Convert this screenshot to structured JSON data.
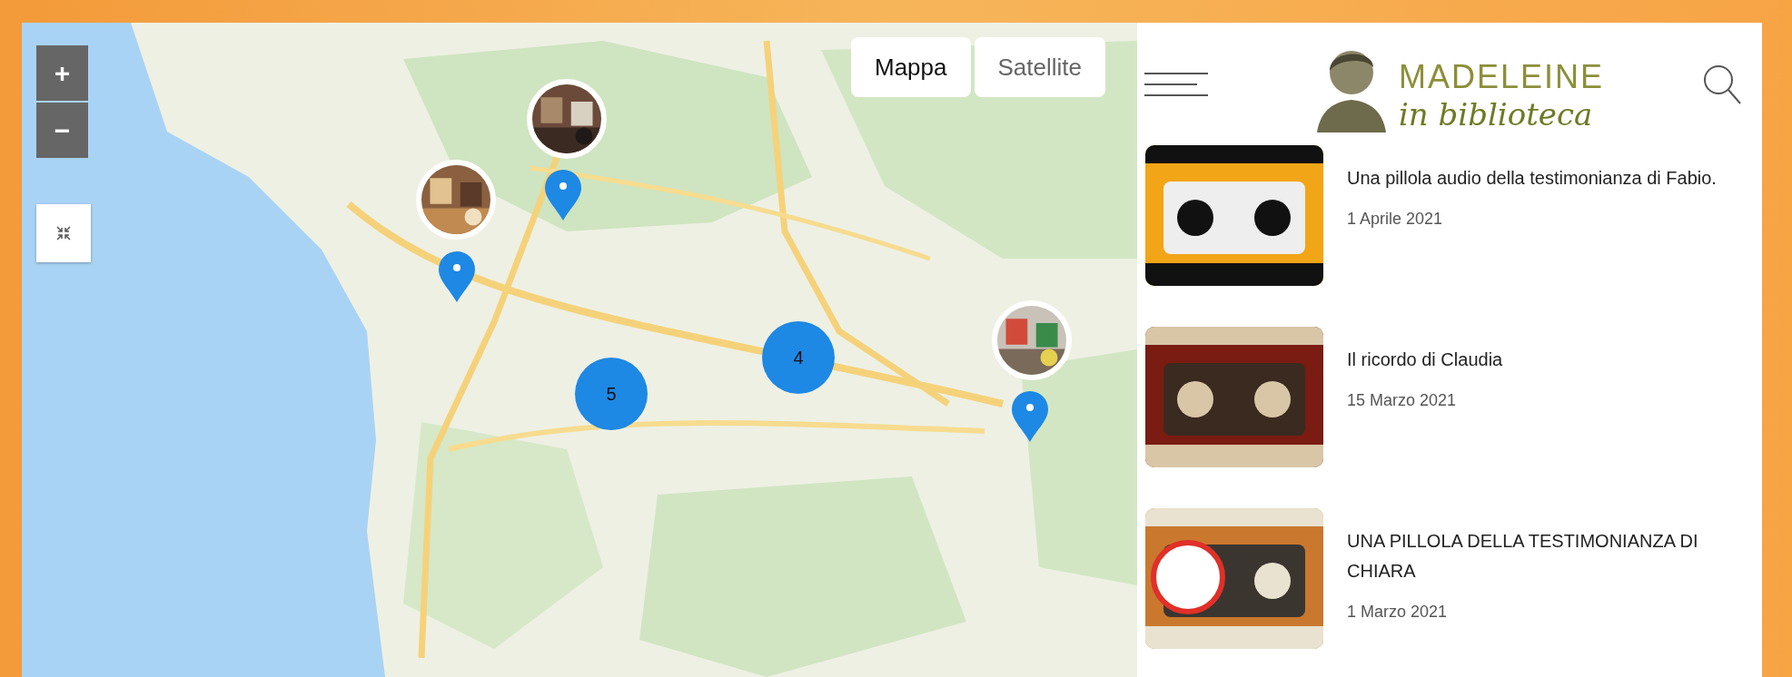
{
  "map": {
    "zoom_in": "+",
    "zoom_out": "−",
    "map_types": [
      {
        "label": "Mappa",
        "selected": true
      },
      {
        "label": "Satellite",
        "selected": false
      }
    ],
    "clusters": [
      "5",
      "4"
    ]
  },
  "site": {
    "logo": {
      "line_1": "MADELEINE",
      "line_2": "in biblioteca"
    },
    "posts": [
      {
        "title": "Una pillola audio della testimonianza di Fabio.",
        "date": "1 Aprile 2021"
      },
      {
        "title": "Il ricordo di Claudia",
        "date": "15 Marzo 2021"
      },
      {
        "title": "UNA PILLOLA DELLA TESTIMONIANZA DI CHIARA",
        "date": "1 Marzo 2021"
      }
    ]
  }
}
